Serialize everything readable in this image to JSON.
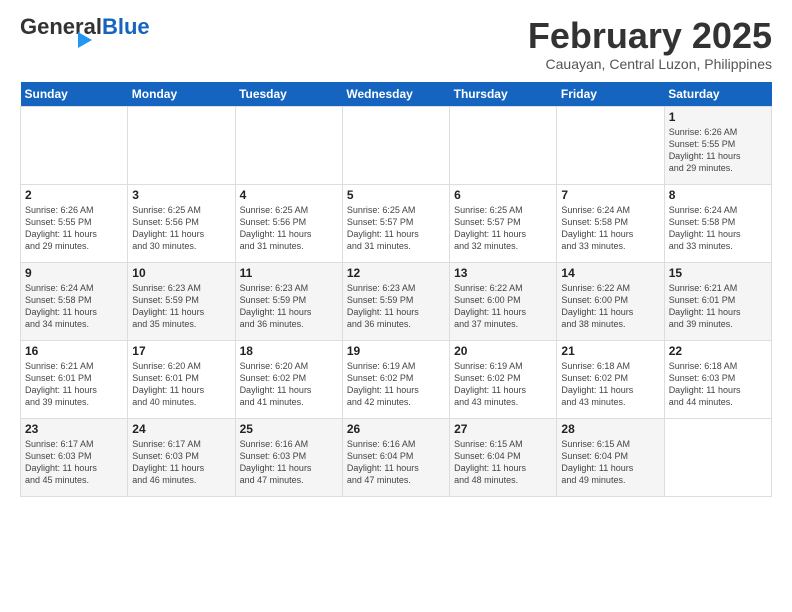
{
  "header": {
    "logo_general": "General",
    "logo_blue": "Blue",
    "month_year": "February 2025",
    "location": "Cauayan, Central Luzon, Philippines"
  },
  "days_of_week": [
    "Sunday",
    "Monday",
    "Tuesday",
    "Wednesday",
    "Thursday",
    "Friday",
    "Saturday"
  ],
  "weeks": [
    [
      {
        "day": "",
        "info": ""
      },
      {
        "day": "",
        "info": ""
      },
      {
        "day": "",
        "info": ""
      },
      {
        "day": "",
        "info": ""
      },
      {
        "day": "",
        "info": ""
      },
      {
        "day": "",
        "info": ""
      },
      {
        "day": "1",
        "info": "Sunrise: 6:26 AM\nSunset: 5:55 PM\nDaylight: 11 hours\nand 29 minutes."
      }
    ],
    [
      {
        "day": "2",
        "info": "Sunrise: 6:26 AM\nSunset: 5:55 PM\nDaylight: 11 hours\nand 29 minutes."
      },
      {
        "day": "3",
        "info": "Sunrise: 6:25 AM\nSunset: 5:56 PM\nDaylight: 11 hours\nand 30 minutes."
      },
      {
        "day": "4",
        "info": "Sunrise: 6:25 AM\nSunset: 5:56 PM\nDaylight: 11 hours\nand 31 minutes."
      },
      {
        "day": "5",
        "info": "Sunrise: 6:25 AM\nSunset: 5:57 PM\nDaylight: 11 hours\nand 31 minutes."
      },
      {
        "day": "6",
        "info": "Sunrise: 6:25 AM\nSunset: 5:57 PM\nDaylight: 11 hours\nand 32 minutes."
      },
      {
        "day": "7",
        "info": "Sunrise: 6:24 AM\nSunset: 5:58 PM\nDaylight: 11 hours\nand 33 minutes."
      },
      {
        "day": "8",
        "info": "Sunrise: 6:24 AM\nSunset: 5:58 PM\nDaylight: 11 hours\nand 33 minutes."
      }
    ],
    [
      {
        "day": "9",
        "info": "Sunrise: 6:24 AM\nSunset: 5:58 PM\nDaylight: 11 hours\nand 34 minutes."
      },
      {
        "day": "10",
        "info": "Sunrise: 6:23 AM\nSunset: 5:59 PM\nDaylight: 11 hours\nand 35 minutes."
      },
      {
        "day": "11",
        "info": "Sunrise: 6:23 AM\nSunset: 5:59 PM\nDaylight: 11 hours\nand 36 minutes."
      },
      {
        "day": "12",
        "info": "Sunrise: 6:23 AM\nSunset: 5:59 PM\nDaylight: 11 hours\nand 36 minutes."
      },
      {
        "day": "13",
        "info": "Sunrise: 6:22 AM\nSunset: 6:00 PM\nDaylight: 11 hours\nand 37 minutes."
      },
      {
        "day": "14",
        "info": "Sunrise: 6:22 AM\nSunset: 6:00 PM\nDaylight: 11 hours\nand 38 minutes."
      },
      {
        "day": "15",
        "info": "Sunrise: 6:21 AM\nSunset: 6:01 PM\nDaylight: 11 hours\nand 39 minutes."
      }
    ],
    [
      {
        "day": "16",
        "info": "Sunrise: 6:21 AM\nSunset: 6:01 PM\nDaylight: 11 hours\nand 39 minutes."
      },
      {
        "day": "17",
        "info": "Sunrise: 6:20 AM\nSunset: 6:01 PM\nDaylight: 11 hours\nand 40 minutes."
      },
      {
        "day": "18",
        "info": "Sunrise: 6:20 AM\nSunset: 6:02 PM\nDaylight: 11 hours\nand 41 minutes."
      },
      {
        "day": "19",
        "info": "Sunrise: 6:19 AM\nSunset: 6:02 PM\nDaylight: 11 hours\nand 42 minutes."
      },
      {
        "day": "20",
        "info": "Sunrise: 6:19 AM\nSunset: 6:02 PM\nDaylight: 11 hours\nand 43 minutes."
      },
      {
        "day": "21",
        "info": "Sunrise: 6:18 AM\nSunset: 6:02 PM\nDaylight: 11 hours\nand 43 minutes."
      },
      {
        "day": "22",
        "info": "Sunrise: 6:18 AM\nSunset: 6:03 PM\nDaylight: 11 hours\nand 44 minutes."
      }
    ],
    [
      {
        "day": "23",
        "info": "Sunrise: 6:17 AM\nSunset: 6:03 PM\nDaylight: 11 hours\nand 45 minutes."
      },
      {
        "day": "24",
        "info": "Sunrise: 6:17 AM\nSunset: 6:03 PM\nDaylight: 11 hours\nand 46 minutes."
      },
      {
        "day": "25",
        "info": "Sunrise: 6:16 AM\nSunset: 6:03 PM\nDaylight: 11 hours\nand 47 minutes."
      },
      {
        "day": "26",
        "info": "Sunrise: 6:16 AM\nSunset: 6:04 PM\nDaylight: 11 hours\nand 47 minutes."
      },
      {
        "day": "27",
        "info": "Sunrise: 6:15 AM\nSunset: 6:04 PM\nDaylight: 11 hours\nand 48 minutes."
      },
      {
        "day": "28",
        "info": "Sunrise: 6:15 AM\nSunset: 6:04 PM\nDaylight: 11 hours\nand 49 minutes."
      },
      {
        "day": "",
        "info": ""
      }
    ]
  ]
}
